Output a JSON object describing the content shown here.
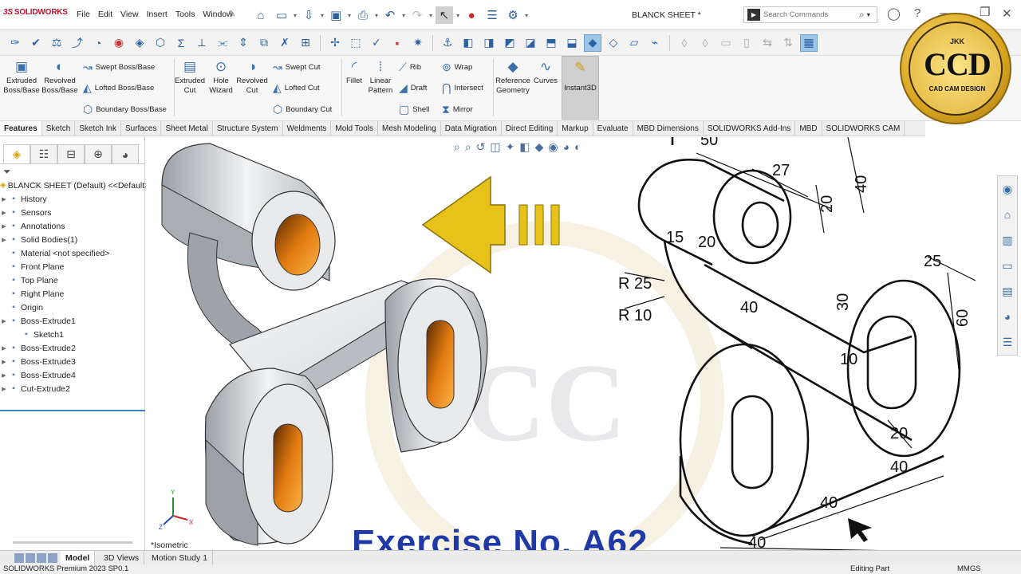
{
  "app": {
    "logo": "SOLIDWORKS",
    "document_title": "BLANCK SHEET *"
  },
  "menu": [
    "File",
    "Edit",
    "View",
    "Insert",
    "Tools",
    "Window"
  ],
  "search": {
    "placeholder": "Search Commands"
  },
  "commands": {
    "extruded_boss": "Extruded Boss/Base",
    "revolved_boss": "Revolved Boss/Base",
    "swept_boss": "Swept Boss/Base",
    "lofted_boss": "Lofted Boss/Base",
    "boundary_boss": "Boundary Boss/Base",
    "extruded_cut": "Extruded Cut",
    "hole_wizard": "Hole Wizard",
    "revolved_cut": "Revolved Cut",
    "swept_cut": "Swept Cut",
    "lofted_cut": "Lofted Cut",
    "boundary_cut": "Boundary Cut",
    "fillet": "Fillet",
    "linear_pattern": "Linear Pattern",
    "rib": "Rib",
    "draft": "Draft",
    "shell": "Shell",
    "wrap": "Wrap",
    "intersect": "Intersect",
    "mirror": "Mirror",
    "reference_geometry": "Reference Geometry",
    "curves": "Curves",
    "instant3d": "Instant3D"
  },
  "tabs": [
    "Features",
    "Sketch",
    "Sketch Ink",
    "Surfaces",
    "Sheet Metal",
    "Structure System",
    "Weldments",
    "Mold Tools",
    "Mesh Modeling",
    "Data Migration",
    "Direct Editing",
    "Markup",
    "Evaluate",
    "MBD Dimensions",
    "SOLIDWORKS Add-Ins",
    "MBD",
    "SOLIDWORKS CAM"
  ],
  "tree": {
    "root": "BLANCK SHEET (Default) <<Default>",
    "items": [
      {
        "label": "History",
        "expand": true
      },
      {
        "label": "Sensors",
        "expand": true
      },
      {
        "label": "Annotations",
        "expand": true
      },
      {
        "label": "Solid Bodies(1)",
        "expand": true
      },
      {
        "label": "Material <not specified>",
        "expand": false
      },
      {
        "label": "Front Plane",
        "expand": false
      },
      {
        "label": "Top Plane",
        "expand": false
      },
      {
        "label": "Right Plane",
        "expand": false
      },
      {
        "label": "Origin",
        "expand": false
      },
      {
        "label": "Boss-Extrude1",
        "expand": true
      },
      {
        "label": "Sketch1",
        "expand": false,
        "child": true
      },
      {
        "label": "Boss-Extrude2",
        "expand": true
      },
      {
        "label": "Boss-Extrude3",
        "expand": true
      },
      {
        "label": "Boss-Extrude4",
        "expand": true
      },
      {
        "label": "Cut-Extrude2",
        "expand": true
      }
    ]
  },
  "viewport": {
    "view_label": "*Isometric",
    "exercise_title": "Exercise No. A62",
    "triad": {
      "x": "X",
      "y": "Y",
      "z": "Z"
    },
    "dimensions": [
      "50",
      "27",
      "40",
      "20",
      "15",
      "20",
      "R 25",
      "R 10",
      "40",
      "30",
      "25",
      "60",
      "10",
      "20",
      "40",
      "40",
      "40"
    ]
  },
  "badge": {
    "top": "JKK",
    "main": "CCD",
    "sub": "CAD CAM DESIGN"
  },
  "bottom_tabs": [
    "Model",
    "3D Views",
    "Motion Study 1"
  ],
  "status": {
    "version": "SOLIDWORKS Premium 2023 SP0.1",
    "mode": "Editing Part",
    "units": "MMGS"
  },
  "colors": {
    "accent_blue": "#1f3aa6",
    "arrow_yellow": "#e6c21a",
    "bore_orange": "#e07a10",
    "badge_gold": "#d8a520"
  }
}
